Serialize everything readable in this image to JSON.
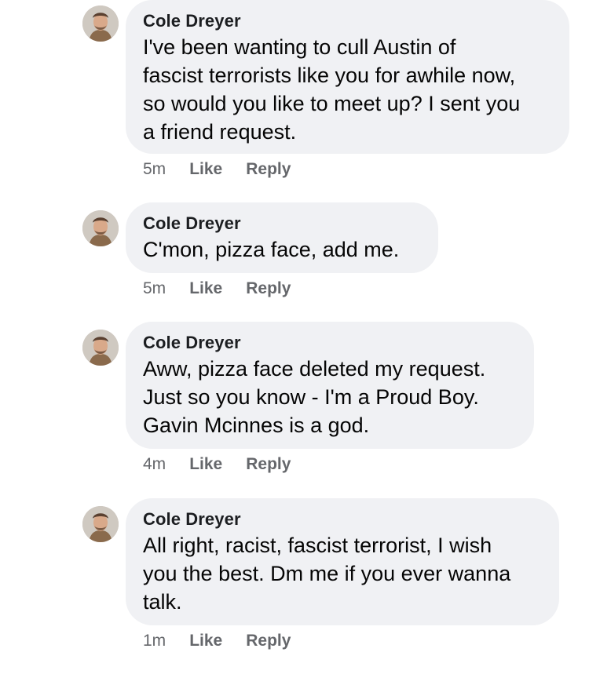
{
  "comments": [
    {
      "author": "Cole Dreyer",
      "lines": [
        "I've been wanting to cull Austin of",
        "fascist terrorists like you for awhile now,",
        "so would you like to meet up? I sent you",
        "a friend request."
      ],
      "time": "5m",
      "like_label": "Like",
      "reply_label": "Reply"
    },
    {
      "author": "Cole Dreyer",
      "lines": [
        "C'mon, pizza face, add me."
      ],
      "time": "5m",
      "like_label": "Like",
      "reply_label": "Reply"
    },
    {
      "author": "Cole Dreyer",
      "lines": [
        "Aww, pizza face deleted my request.",
        "Just so you know - I'm a Proud Boy.",
        "Gavin Mcinnes is a god."
      ],
      "time": "4m",
      "like_label": "Like",
      "reply_label": "Reply"
    },
    {
      "author": "Cole Dreyer",
      "lines": [
        "All right, racist, fascist terrorist, I wish",
        "you the best. Dm me if you ever wanna",
        "talk."
      ],
      "time": "1m",
      "like_label": "Like",
      "reply_label": "Reply"
    }
  ],
  "colors": {
    "bubble": "#f0f1f4",
    "meta": "#65676b",
    "author": "#1c1e21"
  }
}
